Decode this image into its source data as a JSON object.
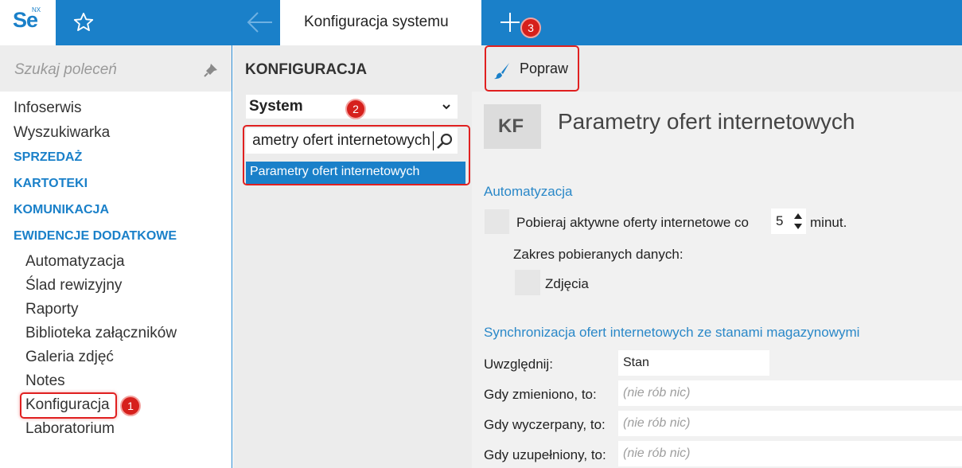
{
  "app": {
    "logo": "Se",
    "logo_sup": "NX"
  },
  "tabs": {
    "active": "Konfiguracja systemu"
  },
  "sidebar": {
    "search_placeholder": "Szukaj poleceń",
    "items": [
      "Infoserwis",
      "Wyszukiwarka"
    ],
    "sections": [
      "SPRZEDAŻ",
      "KARTOTEKI",
      "KOMUNIKACJA",
      "EWIDENCJE DODATKOWE"
    ],
    "sub_items": [
      "Automatyzacja",
      "Ślad rewizyjny",
      "Raporty",
      "Biblioteka załączników",
      "Galeria zdjęć",
      "Notes",
      "Konfiguracja",
      "Laboratorium"
    ]
  },
  "middle": {
    "title": "KONFIGURACJA",
    "select_value": "System",
    "filter_value": "ametry ofert internetowych",
    "result": "Parametry ofert internetowych"
  },
  "toolbar": {
    "edit_label": "Popraw"
  },
  "header": {
    "abbr": "KF",
    "title": "Parametry ofert internetowych"
  },
  "form": {
    "automation": {
      "title": "Automatyzacja",
      "fetch_label": "Pobieraj aktywne oferty internetowe co",
      "interval": "5",
      "unit": "minut.",
      "scope_label": "Zakres pobieranych danych:",
      "photos_label": "Zdjęcia"
    },
    "sync": {
      "title": "Synchronizacja ofert internetowych ze stanami magazynowymi",
      "include_label": "Uwzględnij:",
      "include_value": "Stan",
      "changed_label": "Gdy zmieniono, to:",
      "changed_value": "(nie rób nic)",
      "empty_label": "Gdy wyczerpany, to:",
      "empty_value": "(nie rób nic)",
      "refilled_label": "Gdy uzupełniony, to:",
      "refilled_value": "(nie rób nic)"
    }
  },
  "annotations": [
    "1",
    "2",
    "3"
  ],
  "colors": {
    "accent": "#1a80c9",
    "annotation": "#d6201c",
    "panel": "#ececec"
  }
}
